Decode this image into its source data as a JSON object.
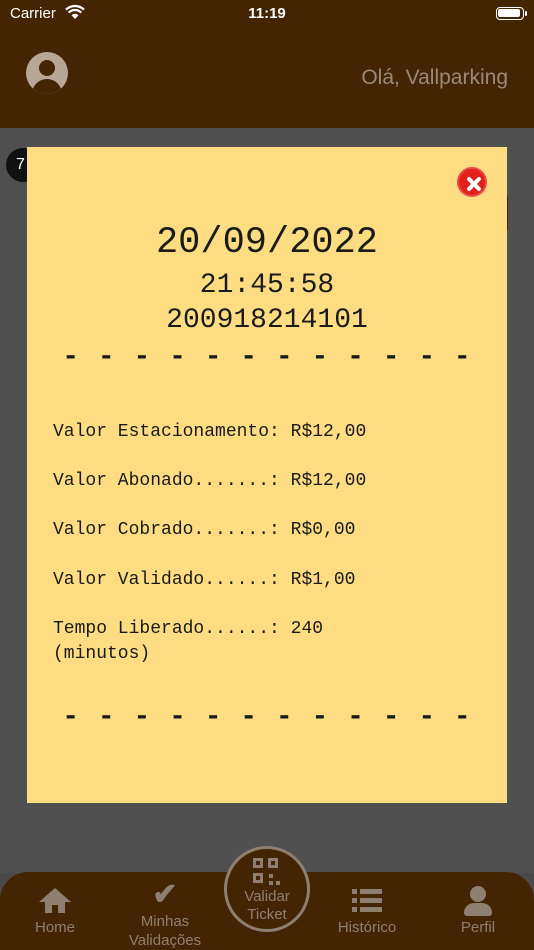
{
  "status_bar": {
    "carrier": "Carrier",
    "time": "11:19"
  },
  "header": {
    "greeting": "Olá, Vallparking"
  },
  "background": {
    "badge_text": "7"
  },
  "ticket": {
    "date": "20/09/2022",
    "time": "21:45:58",
    "code": "200918214101",
    "separator": "- - - - - - - - - - - -",
    "lines": [
      "Valor Estacionamento: R$12,00",
      "Valor Abonado.......: R$12,00",
      "Valor Cobrado.......: R$0,00",
      "Valor Validado......: R$1,00",
      "Tempo Liberado......: 240",
      "(minutos)"
    ]
  },
  "tabs": {
    "home": "Home",
    "minhas_l1": "Minhas",
    "minhas_l2": "Validações",
    "validar_l1": "Validar",
    "validar_l2": "Ticket",
    "historico": "Histórico",
    "perfil": "Perfil"
  },
  "icons": [
    "wifi-icon",
    "battery-icon",
    "avatar-icon",
    "close-icon",
    "home-icon",
    "check-icon",
    "qr-code-icon",
    "list-icon",
    "person-icon"
  ],
  "colors": {
    "header": "#442503",
    "ticket": "#fedd82",
    "close": "#e4201c",
    "tab_inactive": "#8f7f70"
  }
}
